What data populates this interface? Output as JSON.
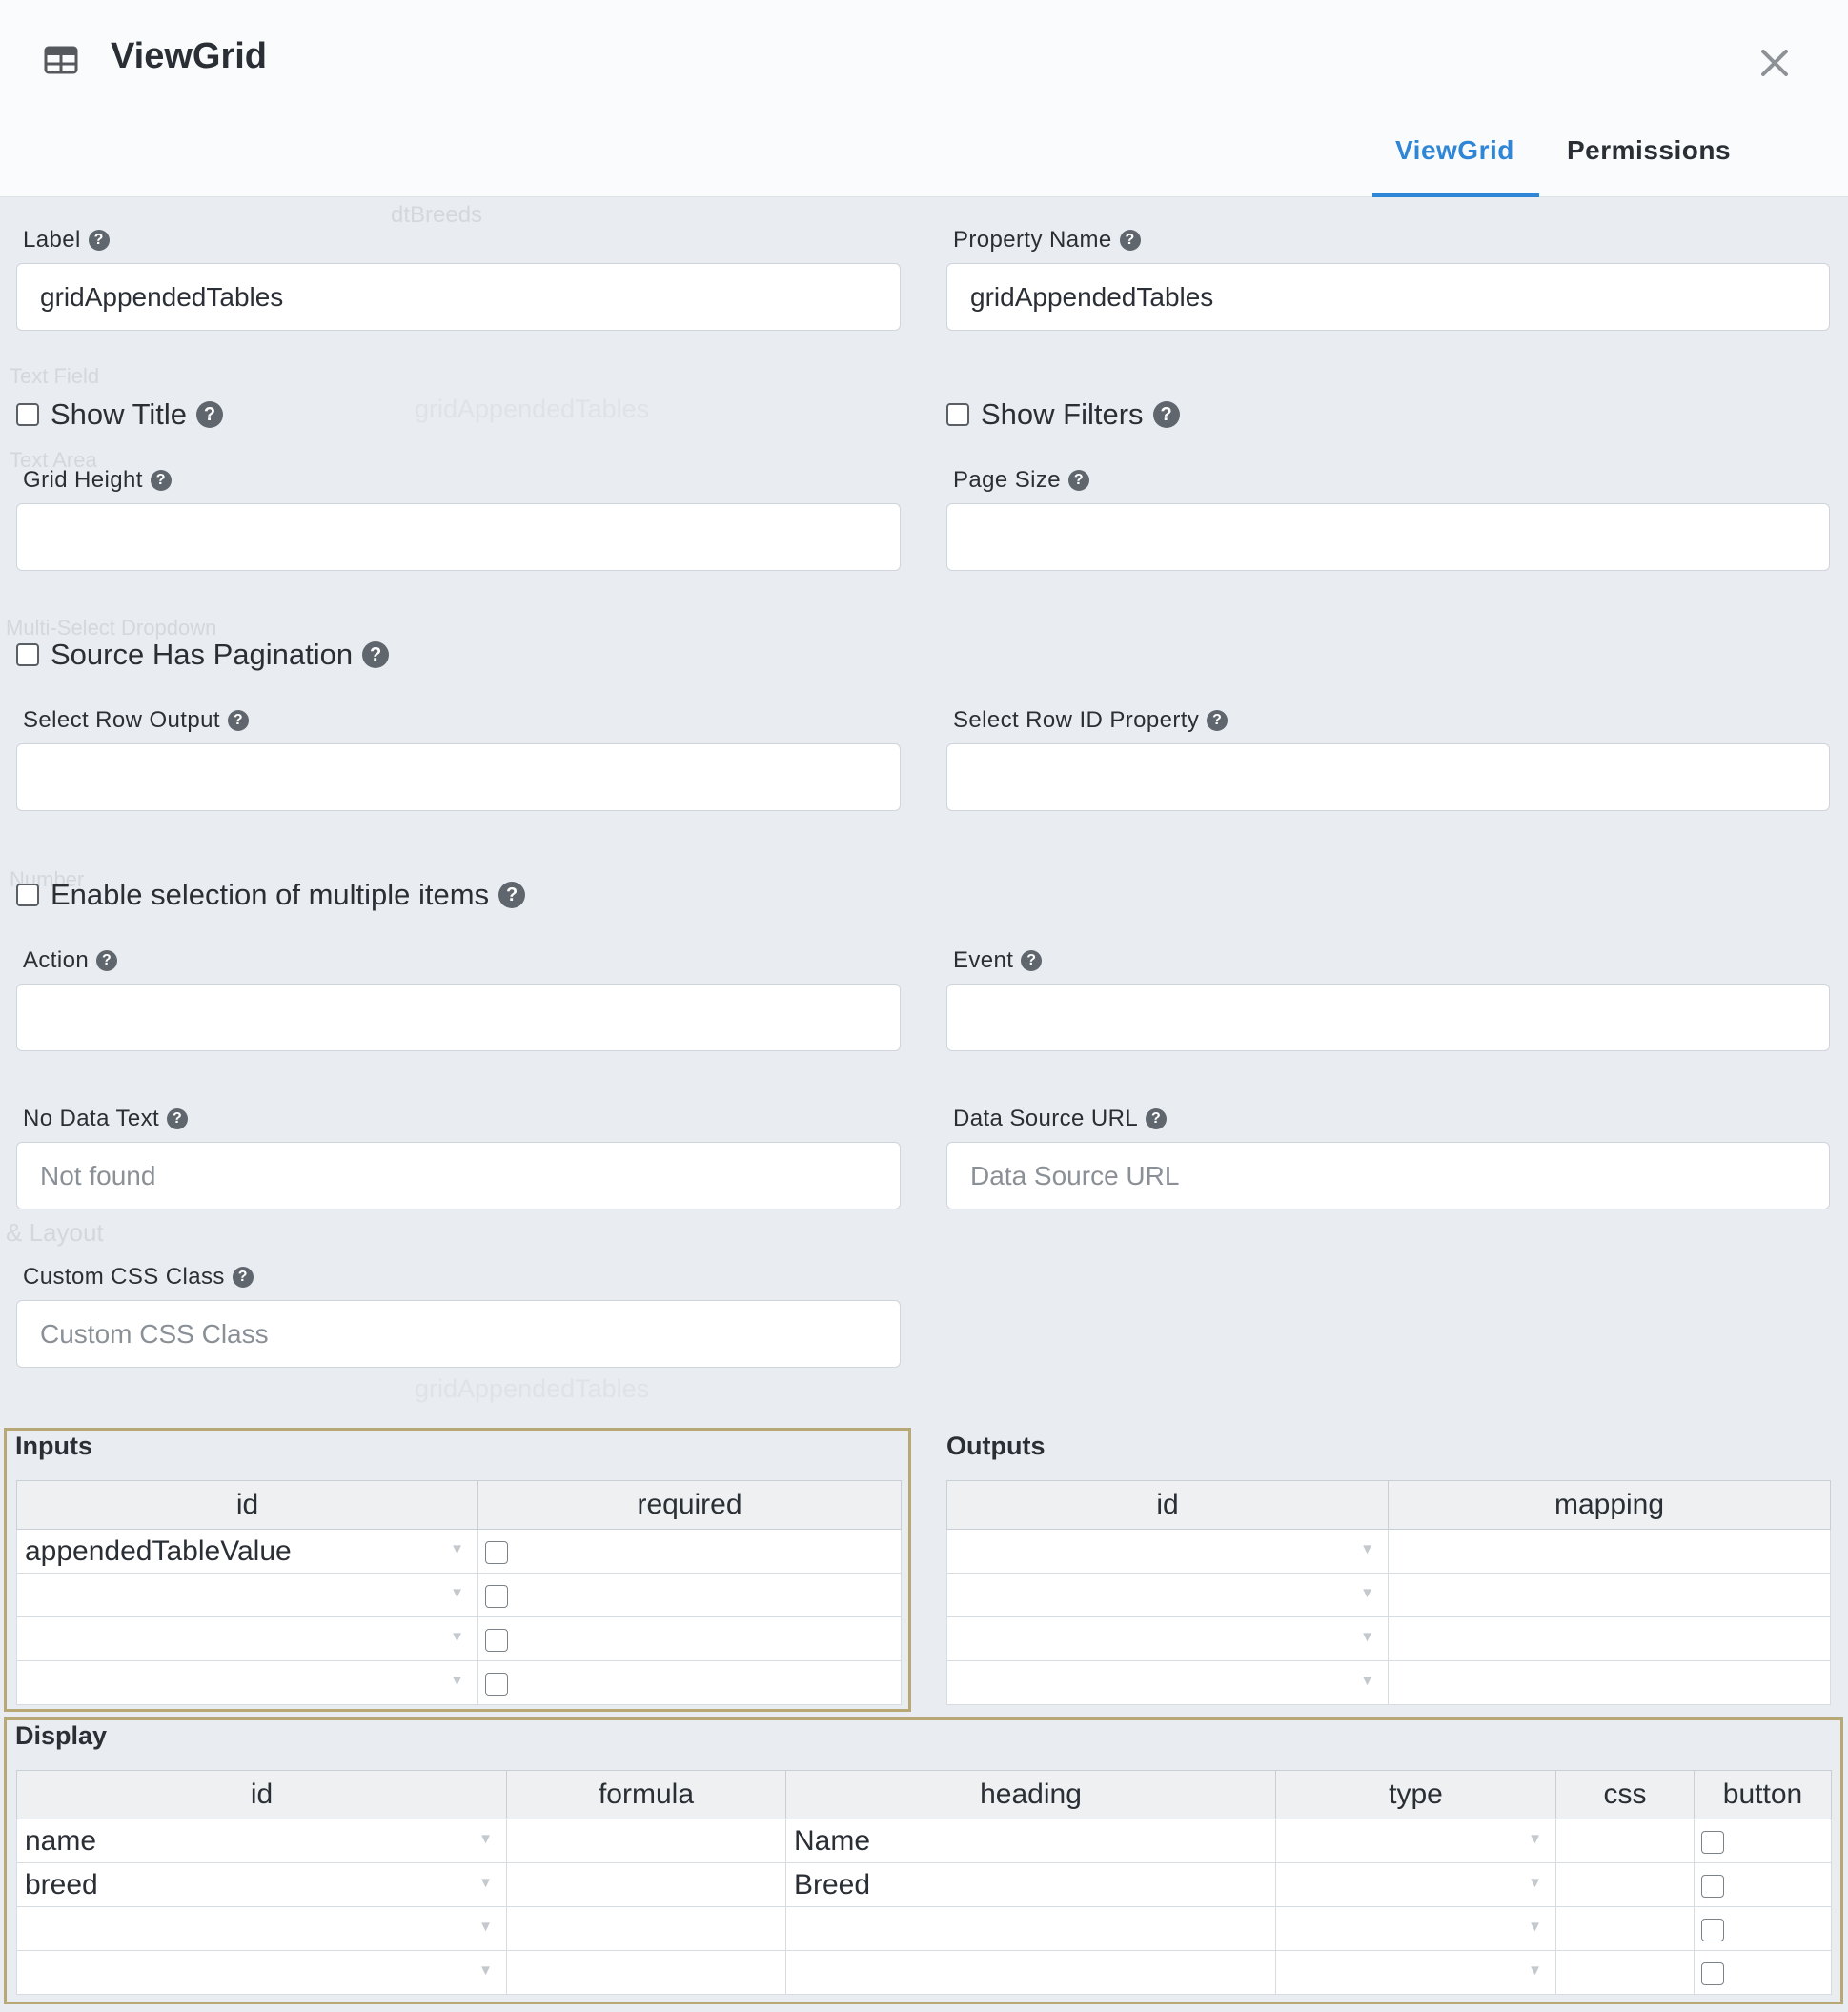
{
  "header": {
    "title": "ViewGrid",
    "tabs": [
      {
        "label": "ViewGrid",
        "active": true
      },
      {
        "label": "Permissions",
        "active": false
      }
    ],
    "accent_color": "#2f86d6"
  },
  "background_ghost": {
    "items": [
      "dtBreeds",
      "Text Field",
      "gridAppendedTables",
      "Text Area",
      "Multi-Select Dropdown",
      "Number",
      "& Layout",
      "gridAppendedTables"
    ]
  },
  "form": {
    "label": {
      "label": "Label",
      "value": "gridAppendedTables"
    },
    "property_name": {
      "label": "Property Name",
      "value": "gridAppendedTables"
    },
    "show_title": {
      "label": "Show Title",
      "checked": false
    },
    "show_filters": {
      "label": "Show Filters",
      "checked": false
    },
    "grid_height": {
      "label": "Grid Height",
      "value": ""
    },
    "page_size": {
      "label": "Page Size",
      "value": ""
    },
    "source_has_pagination": {
      "label": "Source Has Pagination",
      "checked": false
    },
    "select_row_output": {
      "label": "Select Row Output",
      "value": ""
    },
    "select_row_id_property": {
      "label": "Select Row ID Property",
      "value": ""
    },
    "enable_multi_select": {
      "label": "Enable selection of multiple items",
      "checked": false
    },
    "action": {
      "label": "Action",
      "value": ""
    },
    "event": {
      "label": "Event",
      "value": ""
    },
    "no_data_text": {
      "label": "No Data Text",
      "placeholder": "Not found"
    },
    "data_source_url": {
      "label": "Data Source URL",
      "placeholder": "Data Source URL"
    },
    "custom_css_class": {
      "label": "Custom CSS Class",
      "placeholder": "Custom CSS Class"
    }
  },
  "inputs": {
    "title": "Inputs",
    "columns": [
      "id",
      "required"
    ],
    "rows": [
      {
        "id": "appendedTableValue",
        "required": false
      },
      {
        "id": "",
        "required": false
      },
      {
        "id": "",
        "required": false
      },
      {
        "id": "",
        "required": false
      }
    ]
  },
  "outputs": {
    "title": "Outputs",
    "columns": [
      "id",
      "mapping"
    ],
    "rows": [
      {
        "id": "",
        "mapping": ""
      },
      {
        "id": "",
        "mapping": ""
      },
      {
        "id": "",
        "mapping": ""
      },
      {
        "id": "",
        "mapping": ""
      }
    ]
  },
  "display": {
    "title": "Display",
    "columns": [
      "id",
      "formula",
      "heading",
      "type",
      "css",
      "button"
    ],
    "rows": [
      {
        "id": "name",
        "formula": "",
        "heading": "Name",
        "type": "",
        "css": "",
        "button": false
      },
      {
        "id": "breed",
        "formula": "",
        "heading": "Breed",
        "type": "",
        "css": "",
        "button": false
      },
      {
        "id": "",
        "formula": "",
        "heading": "",
        "type": "",
        "css": "",
        "button": false
      },
      {
        "id": "",
        "formula": "",
        "heading": "",
        "type": "",
        "css": "",
        "button": false
      }
    ]
  },
  "highlight_color": "#b8a876"
}
